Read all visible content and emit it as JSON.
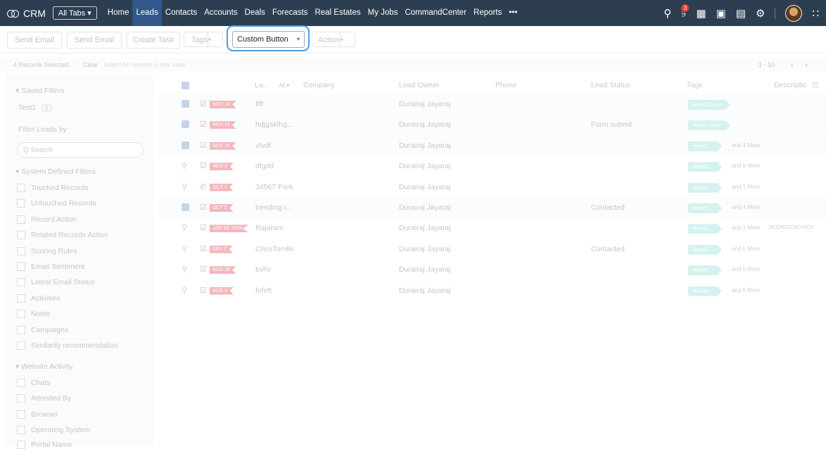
{
  "nav": {
    "brand": "CRM",
    "all_tabs": "All Tabs ▾",
    "tabs": [
      "Home",
      "Leads",
      "Contacts",
      "Accounts",
      "Deals",
      "Forecasts",
      "Real Estates",
      "My Jobs",
      "CommandCenter",
      "Reports",
      "•••"
    ],
    "active_tab": "Leads",
    "notification_count": "3"
  },
  "toolbar": {
    "send_email_1": "Send Email",
    "send_email_2": "Send Email",
    "create_task": "Create Task",
    "tags": "Tags",
    "custom_button": "Custom Button",
    "action": "Action",
    "dropdown_arrow": "▾"
  },
  "selection": {
    "text": "4 Records Selected.",
    "clear": "Clear",
    "select_all": "Select All records in this view",
    "pagination": "1 - 10",
    "prev": "‹",
    "next": "›"
  },
  "sidebar": {
    "saved_filters": "▾  Saved Filters",
    "saved_item": "Test1",
    "saved_count": "0",
    "filter_by": "Filter Leads by",
    "search_placeholder": "Q Search",
    "system_filters": "▾  System Defined Filters",
    "system_items": [
      "Touched Records",
      "Untouched Records",
      "Record Action",
      "Related Records Action",
      "Scoring Rules",
      "Email Sentiment",
      "Latest Email Status",
      "Activities",
      "Notes",
      "Campaigns",
      "Similarity recommendation"
    ],
    "website_activity": "▾  Website Activity",
    "website_items": [
      "Chats",
      "Attended By",
      "Browser",
      "Operating System",
      "Portal Name"
    ]
  },
  "table": {
    "headers": {
      "name": "La...",
      "all": "All ▾",
      "company": "Company",
      "owner": "Lead Owner",
      "phone": "Phone",
      "status": "Lead Status",
      "tags": "Tags",
      "description": "Descriptic",
      "columns_icon": "☷"
    },
    "rows": [
      {
        "selected": true,
        "flag": "NOV 14",
        "name": "ffff",
        "owner": "Durairaj Jayaraj",
        "status": "",
        "tag": "Health Care",
        "more": "",
        "desc": ""
      },
      {
        "selected": true,
        "flag": "NOV 14",
        "name": "hdjgskfhg...",
        "owner": "Durairaj Jayaraj",
        "status": "Form submit",
        "tag": "Health Care",
        "more": "",
        "desc": ""
      },
      {
        "selected": true,
        "flag": "NOV 15",
        "name": "vfvdf",
        "owner": "Durairaj Jayaraj",
        "status": "",
        "tag": "Health...",
        "more": "and 4 More",
        "desc": ""
      },
      {
        "selected": false,
        "flag": "NOV 9",
        "name": "dfgdd",
        "owner": "Durairaj Jayaraj",
        "status": "",
        "tag": "Health...",
        "more": "and 9 More",
        "desc": ""
      },
      {
        "selected": false,
        "flag": "OCT 7",
        "name": "34567 Park",
        "owner": "Durairaj Jayaraj",
        "status": "",
        "tag": "Health...",
        "more": "and 1 More",
        "desc": "",
        "phone_icon": true
      },
      {
        "selected": true,
        "flag": "OCT 5",
        "name": "trending r...",
        "owner": "Durairaj Jayaraj",
        "status": "Contacted",
        "tag": "Health...",
        "more": "and 4 More",
        "desc": ""
      },
      {
        "selected": false,
        "flag": "JAN 18, 2024",
        "name": "Rajaram",
        "owner": "Durairaj Jayaraj",
        "status": "",
        "tag": "Health...",
        "more": "and 1 More",
        "desc": "XCCXCCCXCVXCV"
      },
      {
        "selected": false,
        "flag": "SEP 7",
        "name": "ChrisTomlin",
        "owner": "Durairaj Jayaraj",
        "status": "Contacted",
        "tag": "Health...",
        "more": "and 5 More",
        "desc": ""
      },
      {
        "selected": false,
        "flag": "AUG 28",
        "name": "bvhv",
        "owner": "Durairaj Jayaraj",
        "status": "",
        "tag": "Health...",
        "more": "and 5 More",
        "desc": ""
      },
      {
        "selected": false,
        "flag": "AUG 3",
        "name": "fefefr",
        "owner": "Durairaj Jayaraj",
        "status": "",
        "tag": "Health...",
        "more": "and 5 More",
        "desc": ""
      }
    ]
  },
  "colors": {
    "nav_bg": "#2d3e50",
    "active_tab": "#31578c",
    "focus_ring": "#4d9fe0",
    "flag": "#f3b7bd",
    "tag": "#d4f2ee"
  }
}
